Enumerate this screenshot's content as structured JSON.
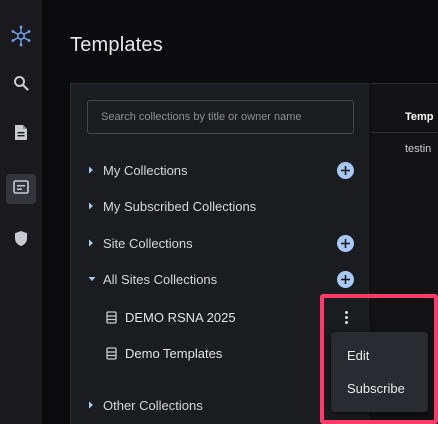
{
  "page": {
    "title": "Templates"
  },
  "sidebar": {
    "items": [
      {
        "icon": "logo-icon",
        "active": false
      },
      {
        "icon": "search-icon",
        "active": false
      },
      {
        "icon": "document-icon",
        "active": false
      },
      {
        "icon": "templates-icon",
        "active": true
      },
      {
        "icon": "shield-icon",
        "active": false
      }
    ]
  },
  "search": {
    "placeholder": "Search collections by title or owner name"
  },
  "collections": {
    "my": {
      "label": "My Collections"
    },
    "subscribed": {
      "label": "My Subscribed Collections"
    },
    "site": {
      "label": "Site Collections"
    },
    "all_sites": {
      "label": "All Sites Collections",
      "children": [
        {
          "label": "DEMO RSNA 2025"
        },
        {
          "label": "Demo Templates"
        }
      ]
    },
    "other": {
      "label": "Other Collections"
    }
  },
  "context_menu": {
    "edit_label": "Edit",
    "subscribe_label": "Subscribe"
  },
  "table": {
    "header": "Temp",
    "first_cell": "testin"
  },
  "colors": {
    "accent": "#a8c8f8",
    "highlight": "#ff3b6b",
    "rail": "#1a1a1e"
  }
}
